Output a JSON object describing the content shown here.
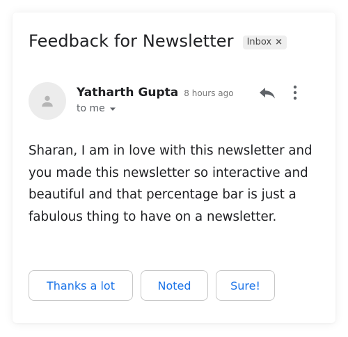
{
  "email": {
    "subject": "Feedback for Newsletter",
    "label": "Inbox",
    "label_close": "×"
  },
  "sender": {
    "name": "Yatharth Gupta",
    "time": "8 hours ago",
    "recipient": "to me"
  },
  "icons": {
    "avatar": "person-icon",
    "reply": "reply-icon",
    "more": "more-vert-icon",
    "dropdown": "caret-down-icon"
  },
  "message": {
    "body": "Sharan, I am in love with this newsletter and you made this newsletter so interactive and beautiful and that percentage bar is just a fabulous thing to have on a newsletter."
  },
  "smart_replies": [
    "Thanks a lot",
    "Noted",
    "Sure!"
  ],
  "colors": {
    "accent": "#1a73e8",
    "text": "#202124",
    "muted": "#777777"
  }
}
